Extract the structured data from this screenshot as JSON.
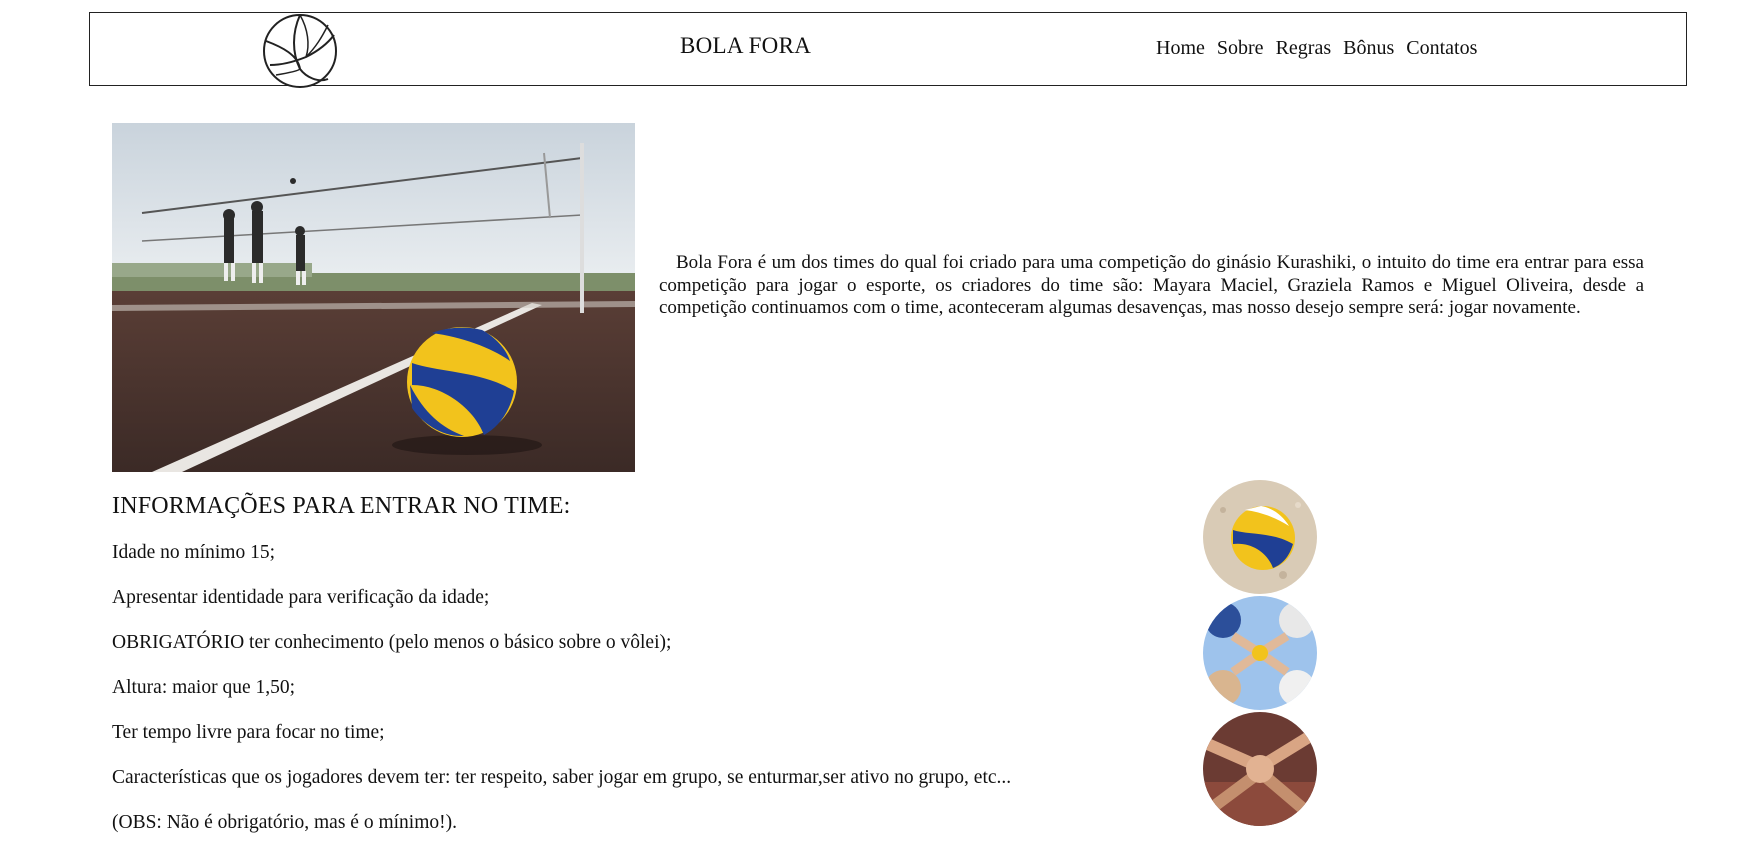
{
  "header": {
    "logo_icon": "volleyball-icon",
    "brand": "BOLA FORA",
    "nav": [
      "Home",
      "Sobre",
      "Regras",
      "Bônus",
      "Contatos"
    ]
  },
  "hero": {
    "image": "volleyball-court-photo",
    "intro": "Bola Fora é um dos times do qual foi criado para uma competição do ginásio Kurashiki, o intuito do time era entrar para essa competição para jogar o esporte, os criadores do time são: Mayara Maciel, Graziela Ramos e Miguel Oliveira, desde a competição continuamos com o time, aconteceram algumas desavenças, mas nosso desejo sempre será: jogar novamente."
  },
  "info": {
    "title": "INFORMAÇÕES PARA ENTRAR NO TIME:",
    "requirements": [
      "Idade no mínimo 15;",
      "Apresentar identidade para verificação da idade;",
      "OBRIGATÓRIO ter conhecimento (pelo menos o básico sobre o vôlei);",
      "Altura: maior que 1,50;",
      "Ter tempo livre para focar no time;",
      "Características que os jogadores devem ter: ter respeito, saber jogar em grupo, se enturmar,ser ativo no grupo, etc...",
      "(OBS: Não é obrigatório, mas é o mínimo!)."
    ],
    "photos": [
      "ball-on-sand-photo",
      "team-huddle-sky-photo",
      "team-hands-stack-photo"
    ]
  },
  "colors": {
    "text": "#111111",
    "border": "#222222",
    "ball_yellow": "#f2c31c",
    "ball_blue": "#1f3f94"
  }
}
